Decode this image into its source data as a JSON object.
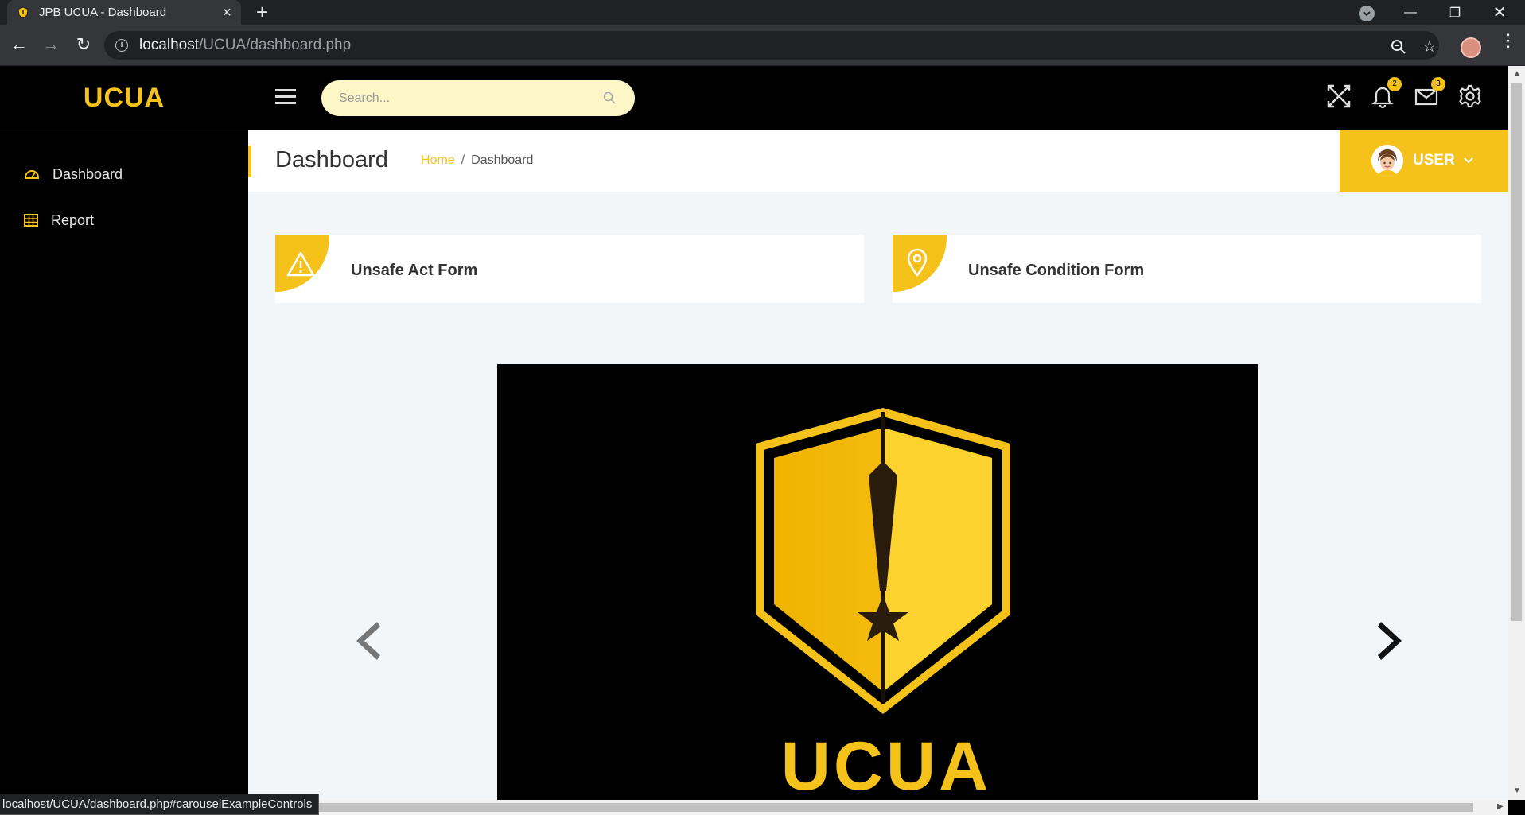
{
  "browser": {
    "tab_title": "JPB UCUA - Dashboard",
    "url_host": "localhost",
    "url_path": "/UCUA/dashboard.php",
    "status_url": "localhost/UCUA/dashboard.php#carouselExampleControls"
  },
  "header": {
    "brand": "UCUA",
    "search_placeholder": "Search...",
    "notifications_count": "2",
    "messages_count": "3"
  },
  "sidebar": {
    "items": [
      {
        "label": "Dashboard",
        "icon": "gauge-icon"
      },
      {
        "label": "Report",
        "icon": "table-icon"
      }
    ]
  },
  "page": {
    "title": "Dashboard",
    "breadcrumb": {
      "home": "Home",
      "separator": "/",
      "current": "Dashboard"
    },
    "user_label": "USER"
  },
  "cards": [
    {
      "label": "Unsafe Act Form",
      "icon": "warning-icon"
    },
    {
      "label": "Unsafe Condition Form",
      "icon": "map-pin-icon"
    }
  ],
  "carousel": {
    "logo_text": "UCUA"
  },
  "colors": {
    "accent": "#f4c21a",
    "sidebar_bg": "#000000",
    "content_bg": "#f2f6f8",
    "search_bg": "#fdf6c6"
  }
}
